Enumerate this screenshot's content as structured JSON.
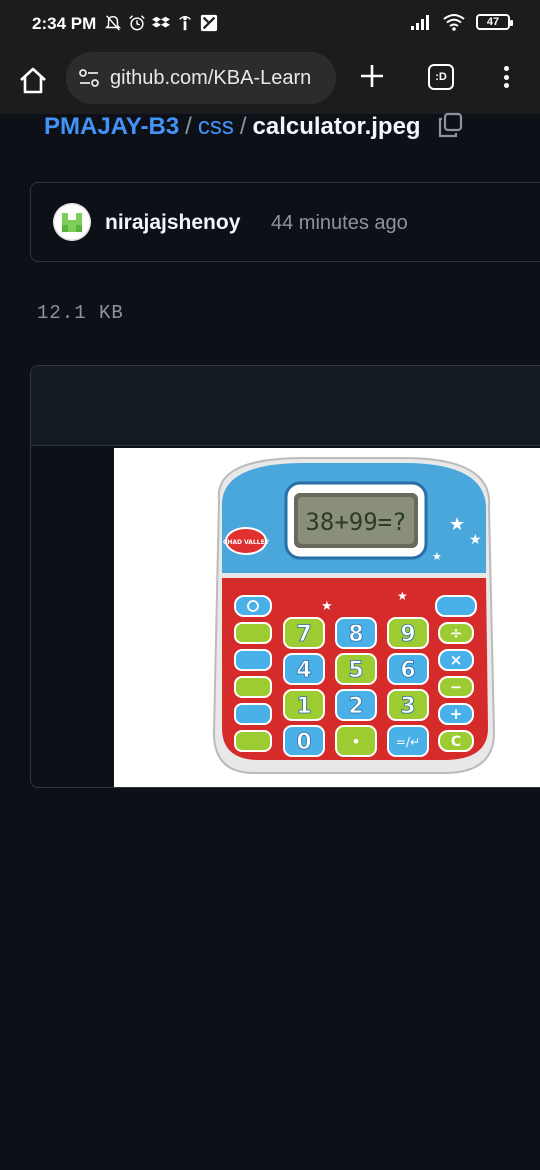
{
  "status_bar": {
    "time": "2:34 PM",
    "battery": "47",
    "icons": [
      "mute-icon",
      "alarm-icon",
      "dropbox-icon",
      "signal-i-icon",
      "app-icon",
      "cellular-signal-icon",
      "wifi-icon",
      "battery-icon"
    ]
  },
  "browser": {
    "url": "github.com/KBA-Learn",
    "tab_count": ":D",
    "icons": [
      "home-icon",
      "site-controls-icon",
      "plus-icon",
      "menu-dots-icon"
    ]
  },
  "breadcrumb": {
    "repo": "PMAJAY-B3",
    "separator": "/",
    "folder": "css",
    "file": "calculator.jpeg"
  },
  "commit": {
    "author": "nirajajshenoy",
    "time": "44 minutes ago"
  },
  "file": {
    "size": "12.1 KB"
  },
  "image": {
    "display_text": "38+99=?",
    "brand": "CHAD VALLEY",
    "keys": {
      "digits": [
        "7",
        "8",
        "9",
        "4",
        "5",
        "6",
        "1",
        "2",
        "3",
        "0"
      ],
      "dot": "•",
      "enter": "=/↵",
      "operators": [
        "÷",
        "×",
        "−",
        "+",
        "C"
      ]
    }
  },
  "colors": {
    "background": "#0d1117",
    "link": "#4493f8",
    "muted": "#8b949e",
    "border": "#30363d",
    "calc_body": "#d62b2b",
    "calc_top": "#4aa7dc",
    "key_green": "#9ccc32",
    "key_blue": "#4ab0e8"
  }
}
